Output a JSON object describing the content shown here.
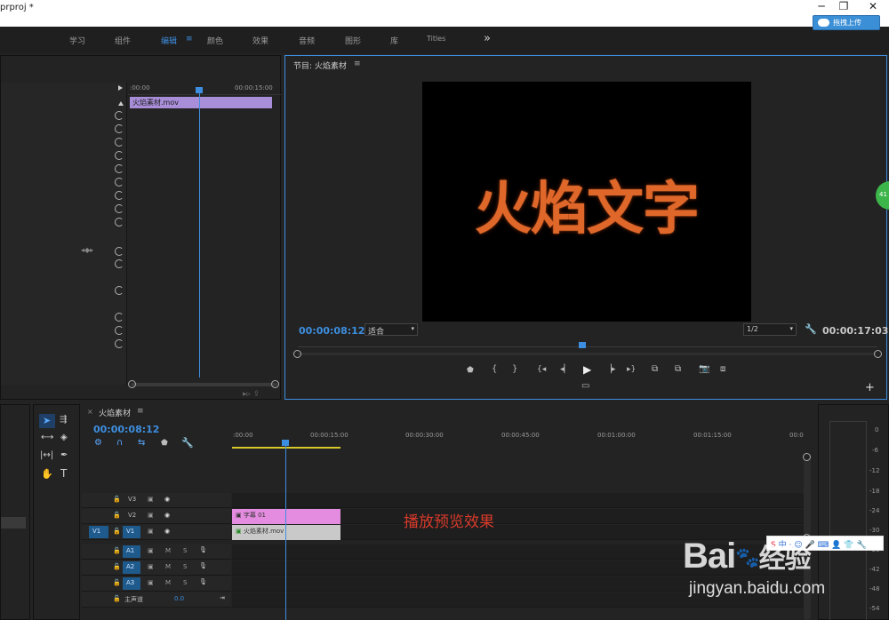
{
  "window": {
    "title": "prproj *",
    "cloud_button": "拖拽上传"
  },
  "workspaces": [
    {
      "label": "学习"
    },
    {
      "label": "组件"
    },
    {
      "label": "编辑"
    },
    {
      "label": "颜色"
    },
    {
      "label": "效果"
    },
    {
      "label": "音频"
    },
    {
      "label": "图形"
    },
    {
      "label": "库"
    },
    {
      "label": "Titles"
    }
  ],
  "workspace_menu_icon": "≡",
  "workspace_more": "»",
  "effect_controls": {
    "ruler_start": ":00:00",
    "ruler_end": "00:00:15:00",
    "clip_name": "火焰素材.mov"
  },
  "program_monitor": {
    "title": "节目: 火焰素材",
    "menu_icon": "≡",
    "video_text": "火焰文字",
    "current_time": "00:00:08:12",
    "zoom": "适合",
    "resolution": "1/2",
    "duration": "00:00:17:03",
    "green_badge": "41"
  },
  "sequence": {
    "tab_close": "×",
    "title": "火焰素材",
    "menu_icon": "≡",
    "current_time": "00:00:08:12",
    "ruler_ticks": [
      ":00:00",
      "00:00:15:00",
      "00:00:30:00",
      "00:00:45:00",
      "00:01:00:00",
      "00:01:15:00",
      "00:0"
    ],
    "video_tracks": [
      {
        "name": "V3",
        "source": ""
      },
      {
        "name": "V2",
        "source": ""
      },
      {
        "name": "V1",
        "source": "V1"
      }
    ],
    "audio_tracks": [
      {
        "name": "A1",
        "m": "M",
        "s": "S"
      },
      {
        "name": "A2",
        "m": "M",
        "s": "S"
      },
      {
        "name": "A3",
        "m": "M",
        "s": "S"
      }
    ],
    "master_label": "主声道",
    "master_value": "0.0",
    "clips": {
      "caption": "字幕 01",
      "video": "火焰素材.mov"
    },
    "annotation": "播放预览效果"
  },
  "audio_meter": {
    "labels": [
      "0",
      "-6",
      "-12",
      "-18",
      "-24",
      "-30",
      "-36",
      "-42",
      "-48",
      "-54"
    ]
  },
  "tools": {
    "type_tool": "T"
  },
  "watermark": {
    "brand": "Bai",
    "brand_cn": "经验",
    "url": "jingyan.baidu.com",
    "ime_text": "中"
  }
}
